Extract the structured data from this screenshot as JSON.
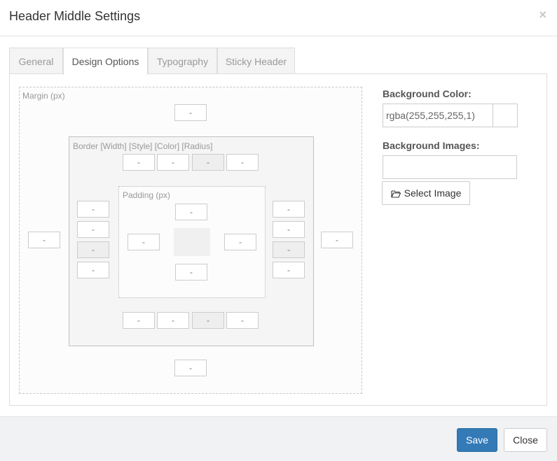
{
  "modal": {
    "title": "Header Middle Settings",
    "close_glyph": "×"
  },
  "tabs": [
    {
      "label": "General",
      "active": false
    },
    {
      "label": "Design Options",
      "active": true
    },
    {
      "label": "Typography",
      "active": false
    },
    {
      "label": "Sticky Header",
      "active": false
    }
  ],
  "box_model": {
    "margin_label": "Margin (px)",
    "border_label": "Border [Width] [Style] [Color] [Radius]",
    "padding_label": "Padding (px)",
    "field_placeholder": "-"
  },
  "background": {
    "color_label": "Background Color:",
    "color_value": "rgba(255,255,255,1)",
    "images_label": "Background Images:",
    "images_value": "",
    "select_image_label": "Select Image"
  },
  "footer": {
    "save_label": "Save",
    "close_label": "Close"
  },
  "colors": {
    "primary": "#337ab7",
    "border": "#cccccc"
  }
}
